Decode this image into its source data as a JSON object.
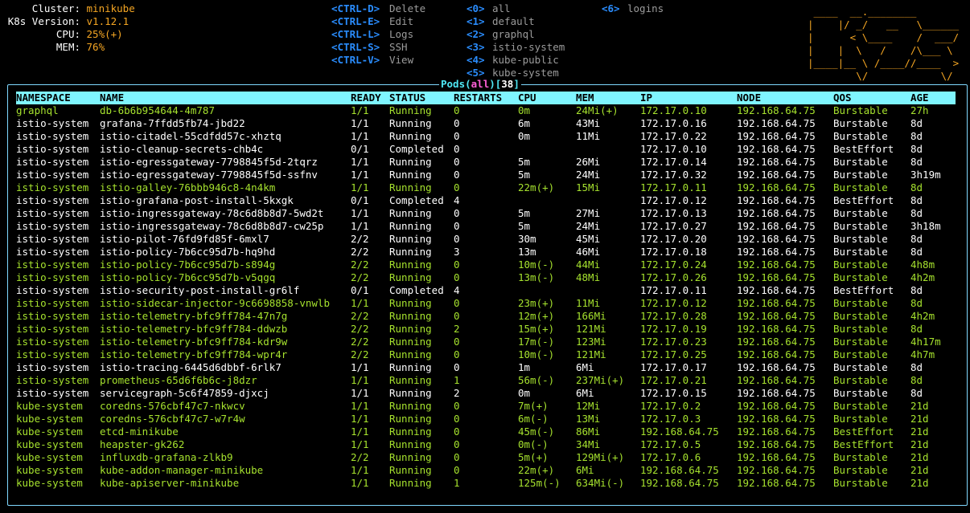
{
  "cluster_info": [
    {
      "label": "Cluster:",
      "value": "minikube"
    },
    {
      "label": "K8s Version:",
      "value": "v1.12.1"
    },
    {
      "label": "CPU:",
      "value": "25%(+)"
    },
    {
      "label": "MEM:",
      "value": "76%"
    }
  ],
  "shortcuts": [
    {
      "key": "<CTRL-D>",
      "label": "Delete"
    },
    {
      "key": "<CTRL-E>",
      "label": "Edit"
    },
    {
      "key": "<CTRL-L>",
      "label": "Logs"
    },
    {
      "key": "<CTRL-S>",
      "label": "SSH"
    },
    {
      "key": "<CTRL-V>",
      "label": "View"
    }
  ],
  "namespaces_col1": [
    {
      "key": "<0>",
      "label": "all"
    },
    {
      "key": "<1>",
      "label": "default"
    },
    {
      "key": "<2>",
      "label": "graphql"
    },
    {
      "key": "<3>",
      "label": "istio-system"
    },
    {
      "key": "<4>",
      "label": "kube-public"
    },
    {
      "key": "<5>",
      "label": "kube-system"
    }
  ],
  "namespaces_col2": [
    {
      "key": "<6>",
      "label": "logins"
    }
  ],
  "logo_art": " ____  __.________        \n|    |/ _/   __   \\______\n|      < \\____    /  ___/\n|    |  \\   /    /\\___ \\ \n|____|__ \\ /____//____  >\n        \\/            \\/ ",
  "panel": {
    "title_prefix": "Pods(",
    "namespace": "all",
    "title_mid": ")[",
    "count": "38",
    "title_suffix": "]"
  },
  "table": {
    "headers": [
      "NAMESPACE",
      "NAME",
      "READY",
      "STATUS",
      "RESTARTS",
      "CPU",
      "MEM",
      "IP",
      "NODE",
      "QOS",
      "AGE"
    ],
    "rows": [
      {
        "c": "g",
        "v": [
          "graphql",
          "db-6b6b954644-4m787",
          "1/1",
          "Running",
          "0",
          "0m",
          "24Mi(+)",
          "172.17.0.10",
          "192.168.64.75",
          "Burstable",
          "27h"
        ]
      },
      {
        "c": "w",
        "v": [
          "istio-system",
          "grafana-7ffdd5fb74-jbd22",
          "1/1",
          "Running",
          "0",
          "6m",
          "43Mi",
          "172.17.0.16",
          "192.168.64.75",
          "Burstable",
          "8d"
        ]
      },
      {
        "c": "w",
        "v": [
          "istio-system",
          "istio-citadel-55cdfdd57c-xhztq",
          "1/1",
          "Running",
          "0",
          "0m",
          "11Mi",
          "172.17.0.22",
          "192.168.64.75",
          "Burstable",
          "8d"
        ]
      },
      {
        "c": "w",
        "v": [
          "istio-system",
          "istio-cleanup-secrets-chb4c",
          "0/1",
          "Completed",
          "0",
          "",
          "",
          "172.17.0.10",
          "192.168.64.75",
          "BestEffort",
          "8d"
        ]
      },
      {
        "c": "w",
        "v": [
          "istio-system",
          "istio-egressgateway-7798845f5d-2tqrz",
          "1/1",
          "Running",
          "0",
          "5m",
          "26Mi",
          "172.17.0.14",
          "192.168.64.75",
          "Burstable",
          "8d"
        ]
      },
      {
        "c": "w",
        "v": [
          "istio-system",
          "istio-egressgateway-7798845f5d-ssfnv",
          "1/1",
          "Running",
          "0",
          "5m",
          "24Mi",
          "172.17.0.32",
          "192.168.64.75",
          "Burstable",
          "3h19m"
        ]
      },
      {
        "c": "g",
        "v": [
          "istio-system",
          "istio-galley-76bbb946c8-4n4km",
          "1/1",
          "Running",
          "0",
          "22m(+)",
          "15Mi",
          "172.17.0.11",
          "192.168.64.75",
          "Burstable",
          "8d"
        ]
      },
      {
        "c": "w",
        "v": [
          "istio-system",
          "istio-grafana-post-install-5kxgk",
          "0/1",
          "Completed",
          "4",
          "",
          "",
          "172.17.0.12",
          "192.168.64.75",
          "BestEffort",
          "8d"
        ]
      },
      {
        "c": "w",
        "v": [
          "istio-system",
          "istio-ingressgateway-78c6d8b8d7-5wd2t",
          "1/1",
          "Running",
          "0",
          "5m",
          "27Mi",
          "172.17.0.13",
          "192.168.64.75",
          "Burstable",
          "8d"
        ]
      },
      {
        "c": "w",
        "v": [
          "istio-system",
          "istio-ingressgateway-78c6d8b8d7-cw25p",
          "1/1",
          "Running",
          "0",
          "5m",
          "24Mi",
          "172.17.0.27",
          "192.168.64.75",
          "Burstable",
          "3h18m"
        ]
      },
      {
        "c": "w",
        "v": [
          "istio-system",
          "istio-pilot-76fd9fd85f-6mxl7",
          "2/2",
          "Running",
          "0",
          "30m",
          "45Mi",
          "172.17.0.20",
          "192.168.64.75",
          "Burstable",
          "8d"
        ]
      },
      {
        "c": "w",
        "v": [
          "istio-system",
          "istio-policy-7b6cc95d7b-hq9hd",
          "2/2",
          "Running",
          "3",
          "13m",
          "46Mi",
          "172.17.0.18",
          "192.168.64.75",
          "Burstable",
          "8d"
        ]
      },
      {
        "c": "g",
        "v": [
          "istio-system",
          "istio-policy-7b6cc95d7b-s894g",
          "2/2",
          "Running",
          "0",
          "10m(-)",
          "44Mi",
          "172.17.0.24",
          "192.168.64.75",
          "Burstable",
          "4h8m"
        ]
      },
      {
        "c": "g",
        "v": [
          "istio-system",
          "istio-policy-7b6cc95d7b-v5qgq",
          "2/2",
          "Running",
          "0",
          "13m(-)",
          "48Mi",
          "172.17.0.26",
          "192.168.64.75",
          "Burstable",
          "4h2m"
        ]
      },
      {
        "c": "w",
        "v": [
          "istio-system",
          "istio-security-post-install-gr6lf",
          "0/1",
          "Completed",
          "4",
          "",
          "",
          "172.17.0.11",
          "192.168.64.75",
          "BestEffort",
          "8d"
        ]
      },
      {
        "c": "g",
        "v": [
          "istio-system",
          "istio-sidecar-injector-9c6698858-vnwlb",
          "1/1",
          "Running",
          "0",
          "23m(+)",
          "11Mi",
          "172.17.0.12",
          "192.168.64.75",
          "Burstable",
          "8d"
        ]
      },
      {
        "c": "g",
        "v": [
          "istio-system",
          "istio-telemetry-bfc9ff784-47n7g",
          "2/2",
          "Running",
          "0",
          "12m(+)",
          "166Mi",
          "172.17.0.28",
          "192.168.64.75",
          "Burstable",
          "4h2m"
        ]
      },
      {
        "c": "g",
        "v": [
          "istio-system",
          "istio-telemetry-bfc9ff784-ddwzb",
          "2/2",
          "Running",
          "2",
          "15m(+)",
          "121Mi",
          "172.17.0.19",
          "192.168.64.75",
          "Burstable",
          "8d"
        ]
      },
      {
        "c": "g",
        "v": [
          "istio-system",
          "istio-telemetry-bfc9ff784-kdr9w",
          "2/2",
          "Running",
          "0",
          "17m(-)",
          "123Mi",
          "172.17.0.23",
          "192.168.64.75",
          "Burstable",
          "4h17m"
        ]
      },
      {
        "c": "g",
        "v": [
          "istio-system",
          "istio-telemetry-bfc9ff784-wpr4r",
          "2/2",
          "Running",
          "0",
          "10m(-)",
          "121Mi",
          "172.17.0.25",
          "192.168.64.75",
          "Burstable",
          "4h7m"
        ]
      },
      {
        "c": "w",
        "v": [
          "istio-system",
          "istio-tracing-6445d6dbbf-6rlk7",
          "1/1",
          "Running",
          "0",
          "1m",
          "6Mi",
          "172.17.0.17",
          "192.168.64.75",
          "Burstable",
          "8d"
        ]
      },
      {
        "c": "g",
        "v": [
          "istio-system",
          "prometheus-65d6f6b6c-j8dzr",
          "1/1",
          "Running",
          "1",
          "56m(-)",
          "237Mi(+)",
          "172.17.0.21",
          "192.168.64.75",
          "Burstable",
          "8d"
        ]
      },
      {
        "c": "w",
        "v": [
          "istio-system",
          "servicegraph-5c6f47859-djxcj",
          "1/1",
          "Running",
          "2",
          "0m",
          "6Mi",
          "172.17.0.15",
          "192.168.64.75",
          "Burstable",
          "8d"
        ]
      },
      {
        "c": "g",
        "v": [
          "kube-system",
          "coredns-576cbf47c7-nkwcv",
          "1/1",
          "Running",
          "0",
          "7m(+)",
          "12Mi",
          "172.17.0.2",
          "192.168.64.75",
          "Burstable",
          "21d"
        ]
      },
      {
        "c": "g",
        "v": [
          "kube-system",
          "coredns-576cbf47c7-w7r4w",
          "1/1",
          "Running",
          "0",
          "6m(-)",
          "13Mi",
          "172.17.0.3",
          "192.168.64.75",
          "Burstable",
          "21d"
        ]
      },
      {
        "c": "g",
        "v": [
          "kube-system",
          "etcd-minikube",
          "1/1",
          "Running",
          "0",
          "45m(-)",
          "86Mi",
          "192.168.64.75",
          "192.168.64.75",
          "BestEffort",
          "21d"
        ]
      },
      {
        "c": "g",
        "v": [
          "kube-system",
          "heapster-gk262",
          "1/1",
          "Running",
          "0",
          "0m(-)",
          "34Mi",
          "172.17.0.5",
          "192.168.64.75",
          "BestEffort",
          "21d"
        ]
      },
      {
        "c": "g",
        "v": [
          "kube-system",
          "influxdb-grafana-zlkb9",
          "2/2",
          "Running",
          "0",
          "5m(+)",
          "129Mi(+)",
          "172.17.0.6",
          "192.168.64.75",
          "Burstable",
          "21d"
        ]
      },
      {
        "c": "g",
        "v": [
          "kube-system",
          "kube-addon-manager-minikube",
          "1/1",
          "Running",
          "0",
          "22m(+)",
          "6Mi",
          "192.168.64.75",
          "192.168.64.75",
          "Burstable",
          "21d"
        ]
      },
      {
        "c": "g",
        "v": [
          "kube-system",
          "kube-apiserver-minikube",
          "1/1",
          "Running",
          "1",
          "125m(-)",
          "634Mi(-)",
          "192.168.64.75",
          "192.168.64.75",
          "Burstable",
          "21d"
        ]
      }
    ]
  }
}
